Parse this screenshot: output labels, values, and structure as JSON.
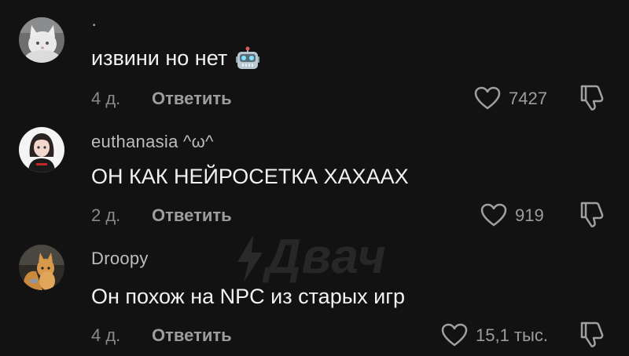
{
  "watermark": "Двач",
  "comments": [
    {
      "username": "·",
      "text": "извини но нет",
      "emoji": "robot-face-icon",
      "time": "4 д.",
      "reply_label": "Ответить",
      "likes": "7427"
    },
    {
      "username": "euthanasia ^ω^",
      "text": "ОН КАК НЕЙРОСЕТКА ХАХААХ",
      "time": "2 д.",
      "reply_label": "Ответить",
      "likes": "919"
    },
    {
      "username": "Droopy",
      "text": "Он похож на NPC из старых игр",
      "time": "4 д.",
      "reply_label": "Ответить",
      "likes": "15,1 тыс."
    }
  ],
  "colors": {
    "background": "#121212",
    "text": "#f2f2f2",
    "secondary": "#9d9d9d"
  }
}
